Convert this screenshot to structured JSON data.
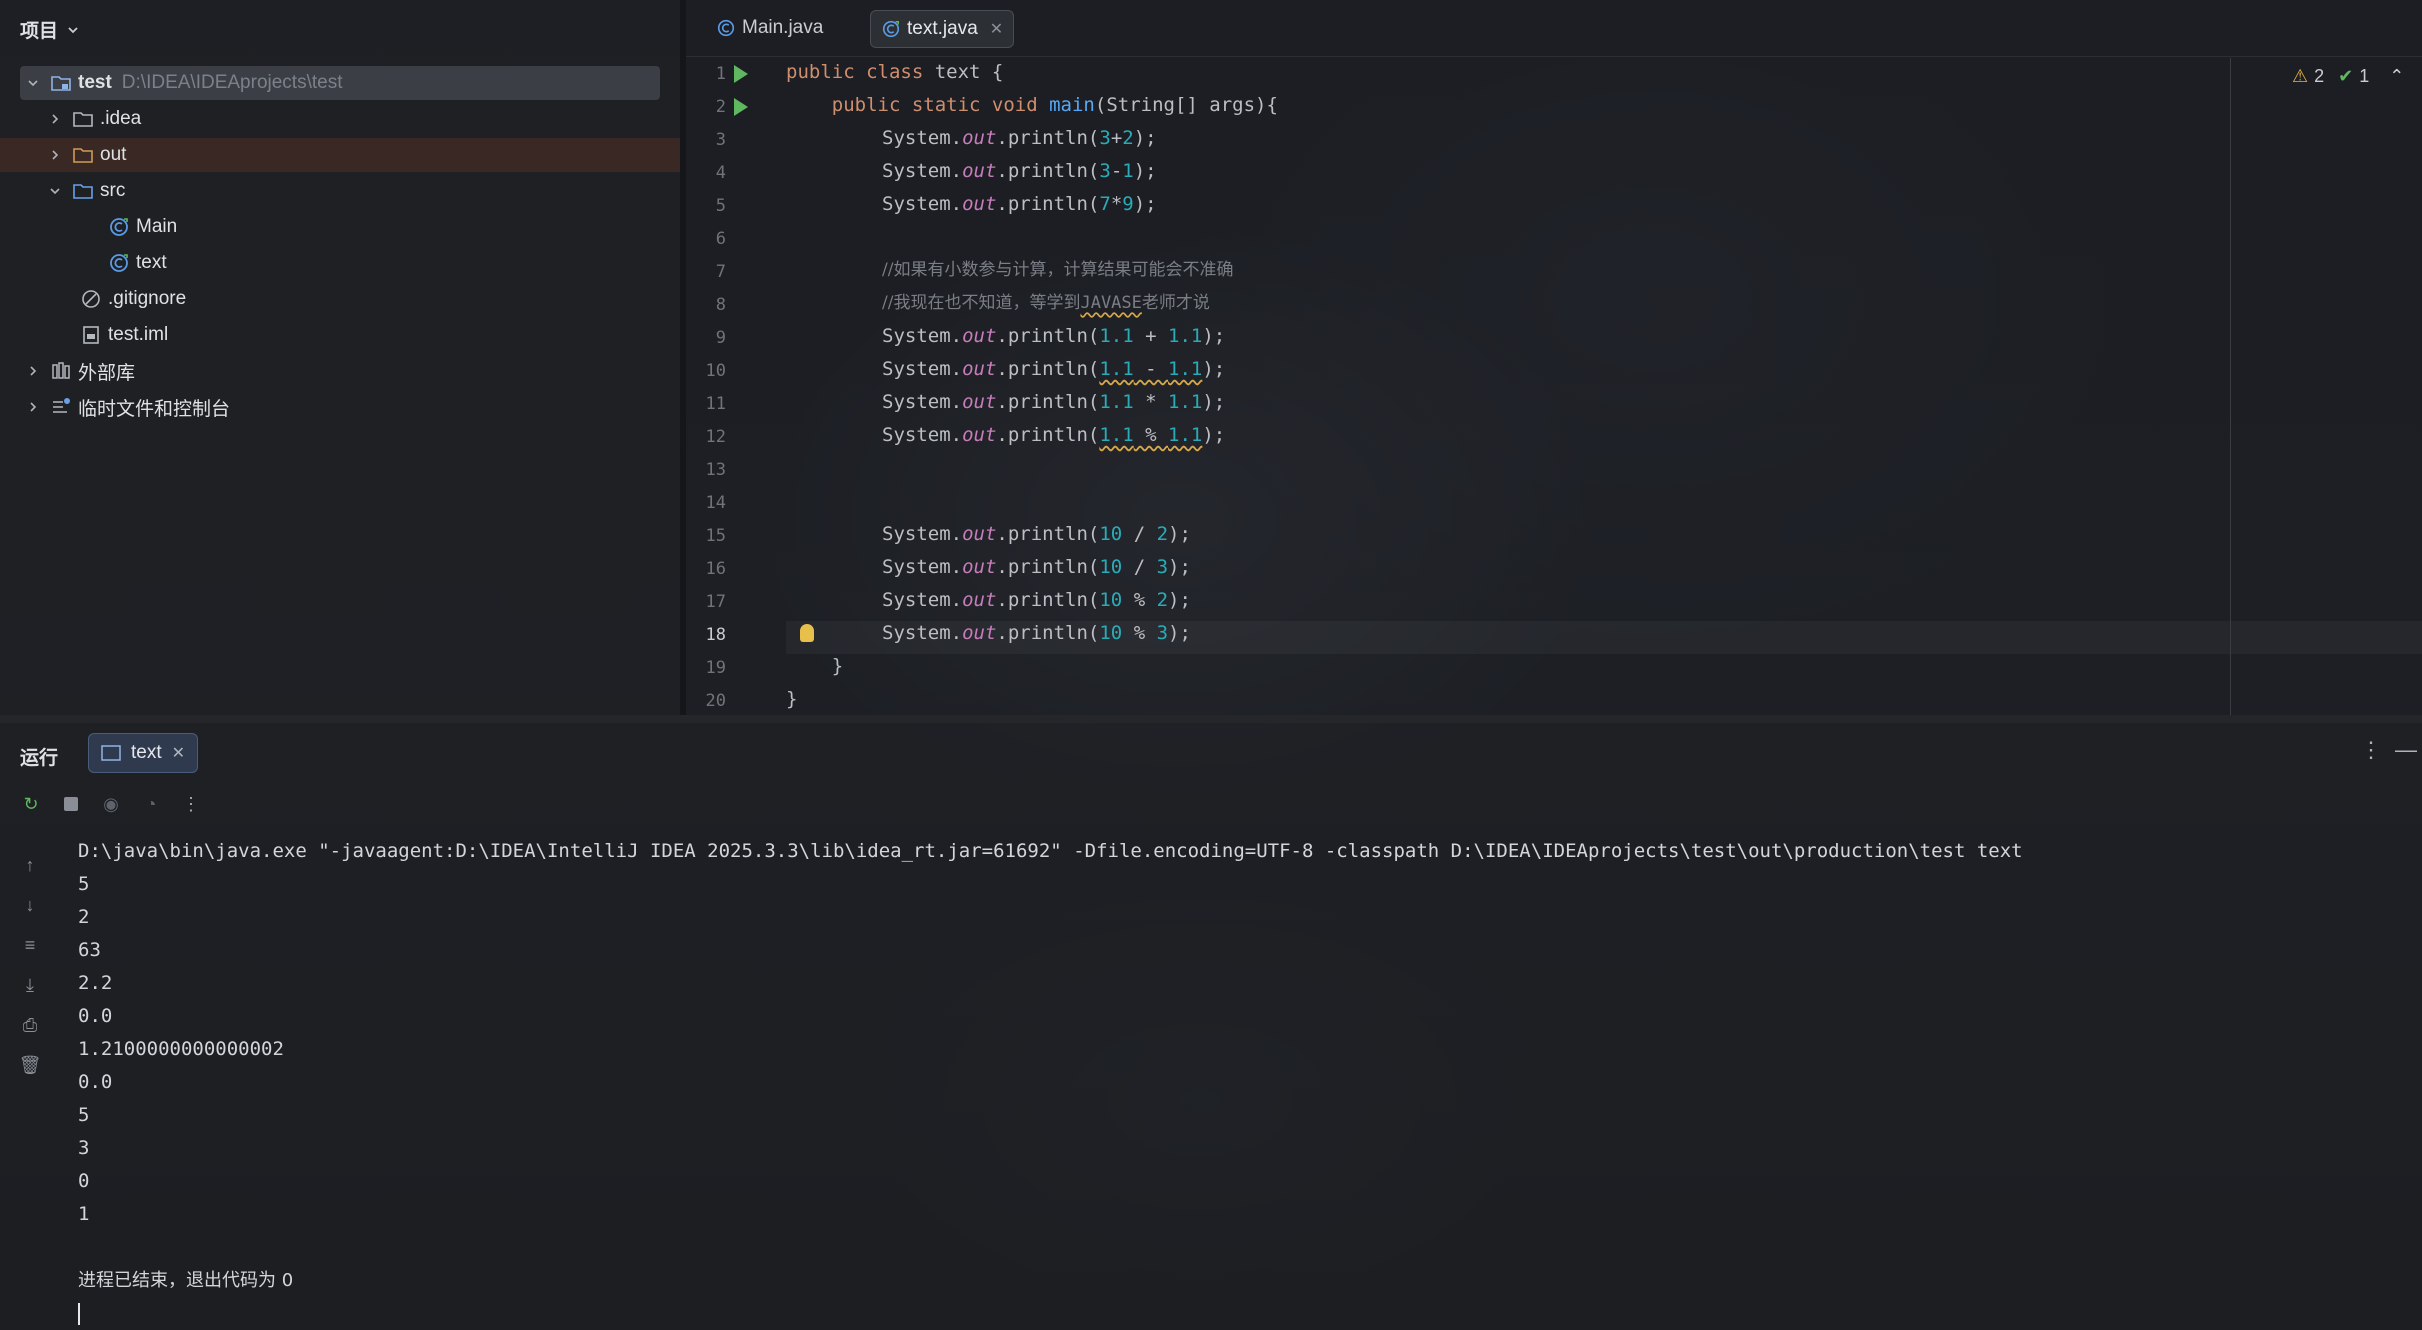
{
  "project": {
    "header": "项目",
    "tree": [
      {
        "label": "test",
        "path": "D:\\IDEA\\IDEAprojects\\test",
        "icon": "module-folder-icon"
      },
      {
        "label": ".idea",
        "icon": "folder-icon"
      },
      {
        "label": "out",
        "icon": "folder-icon"
      },
      {
        "label": "src",
        "icon": "source-folder-icon"
      },
      {
        "label": "Main",
        "icon": "java-class-icon"
      },
      {
        "label": "text",
        "icon": "java-class-icon"
      },
      {
        "label": ".gitignore",
        "icon": "ignore-file-icon"
      },
      {
        "label": "test.iml",
        "icon": "module-file-icon"
      },
      {
        "label": "外部库",
        "icon": "library-icon"
      },
      {
        "label": "临时文件和控制台",
        "icon": "scratches-icon"
      }
    ]
  },
  "editor": {
    "tabs": [
      {
        "label": "Main.java"
      },
      {
        "label": "text.java"
      }
    ],
    "line_numbers": [
      "1",
      "2",
      "3",
      "4",
      "5",
      "6",
      "7",
      "8",
      "9",
      "10",
      "11",
      "12",
      "13",
      "14",
      "15",
      "16",
      "17",
      "18",
      "19",
      "20"
    ],
    "inspections": {
      "warnings": "2",
      "ok": "1"
    },
    "code": {
      "l1": {
        "a": "public class ",
        "b": "text {"
      },
      "l2": {
        "a": "    public static void ",
        "b": "main",
        "c": "(String[] args){"
      },
      "l3": {
        "obj": "System.",
        "out": "out",
        "m": ".println(",
        "n1": "3",
        "op": "+",
        "n2": "2",
        "end": ");"
      },
      "l4": {
        "obj": "System.",
        "out": "out",
        "m": ".println(",
        "n1": "3",
        "op": "-",
        "n2": "1",
        "end": ");"
      },
      "l5": {
        "obj": "System.",
        "out": "out",
        "m": ".println(",
        "n1": "7",
        "op": "*",
        "n2": "9",
        "end": ");"
      },
      "l7": "//如果有小数参与计算，计算结果可能会不准确",
      "l8a": "//我现在也不知道，等学到",
      "l8b": "JAVASE",
      "l8c": "老师才说",
      "l9": {
        "obj": "System.",
        "out": "out",
        "m": ".println(",
        "n1": "1.1",
        "op": " + ",
        "n2": "1.1",
        "end": ");"
      },
      "l10": {
        "obj": "System.",
        "out": "out",
        "m": ".println(",
        "n1": "1.1",
        "op": " - ",
        "n2": "1.1",
        "end": ");"
      },
      "l11": {
        "obj": "System.",
        "out": "out",
        "m": ".println(",
        "n1": "1.1",
        "op": " * ",
        "n2": "1.1",
        "end": ");"
      },
      "l12": {
        "obj": "System.",
        "out": "out",
        "m": ".println(",
        "n1": "1.1",
        "op": " % ",
        "n2": "1.1",
        "end": ");"
      },
      "l15": {
        "obj": "System.",
        "out": "out",
        "m": ".println(",
        "n1": "10",
        "op": " / ",
        "n2": "2",
        "end": ");"
      },
      "l16": {
        "obj": "System.",
        "out": "out",
        "m": ".println(",
        "n1": "10",
        "op": " / ",
        "n2": "3",
        "end": ");"
      },
      "l17": {
        "obj": "System.",
        "out": "out",
        "m": ".println(",
        "n1": "10",
        "op": " % ",
        "n2": "2",
        "end": ");"
      },
      "l18": {
        "obj": "System.",
        "out": "out",
        "m": ".println(",
        "n1": "10",
        "op": " % ",
        "n2": "3",
        "end": ");"
      },
      "l19": "    }",
      "l20": "}"
    }
  },
  "run": {
    "title": "运行",
    "tab_label": "text",
    "command": "D:\\java\\bin\\java.exe \"-javaagent:D:\\IDEA\\IntelliJ IDEA 2025.3.3\\lib\\idea_rt.jar=61692\" -Dfile.encoding=UTF-8 -classpath D:\\IDEA\\IDEAprojects\\test\\out\\production\\test text",
    "output": [
      "5",
      "2",
      "63",
      "2.2",
      "0.0",
      "1.2100000000000002",
      "0.0",
      "5",
      "3",
      "0",
      "1"
    ],
    "exit_message": "进程已结束，退出代码为 0"
  },
  "colors": {
    "keyword": "#cf8e6d",
    "method": "#56a8f5",
    "static_field": "#c77dbb",
    "number": "#2aacb8",
    "comment": "#7a7e85",
    "run_gutter": "#5fb85f"
  }
}
